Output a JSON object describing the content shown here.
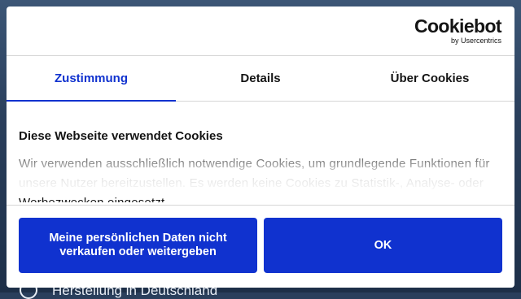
{
  "background": {
    "caption": "Herstellung in Deutschland"
  },
  "logo": {
    "name": "Cookiebot",
    "sub": "by Usercentrics"
  },
  "tabs": [
    {
      "label": "Zustimmung",
      "active": true
    },
    {
      "label": "Details",
      "active": false
    },
    {
      "label": "Über Cookies",
      "active": false
    }
  ],
  "content": {
    "title": "Diese Webseite verwendet Cookies",
    "text": "Wir verwenden ausschließlich notwendige Cookies, um grundlegende Funktionen für unsere Nutzer bereitzustellen. Es werden keine Cookies zu Statistik-, Analyse- oder Werbezwecken eingesetzt."
  },
  "buttons": {
    "decline_label": "Meine persönlichen Daten nicht verkaufen oder weitergeben",
    "ok_label": "OK"
  },
  "colors": {
    "accent": "#1032cf",
    "text": "#141414"
  }
}
